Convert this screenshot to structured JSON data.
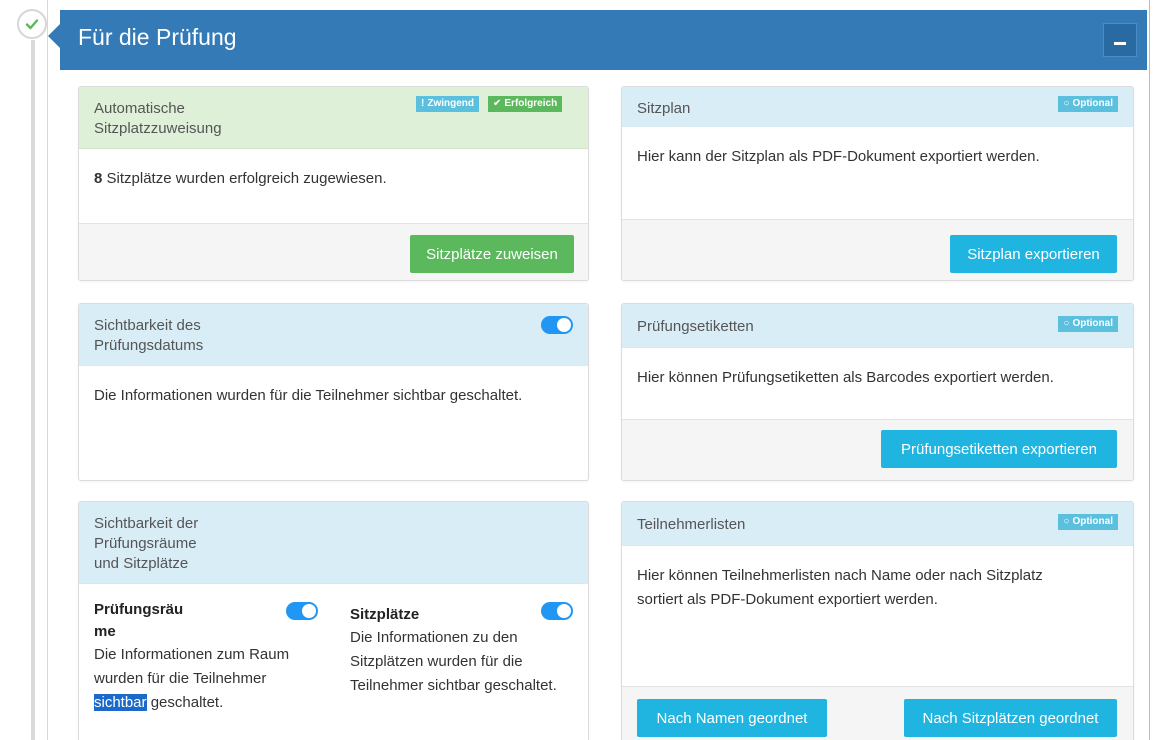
{
  "header": {
    "title": "Für die Prüfung",
    "collapse_icon": "minus-icon"
  },
  "panels": {
    "seat_assignment": {
      "title_line1": "Automatische",
      "title_line2": "Sitzplatzzuweisung",
      "badge_mandatory": "Zwingend",
      "badge_success": "Erfolgreich",
      "count": "8",
      "body": " Sitzplätze wurden erfolgreich zugewiesen.",
      "button": "Sitzplätze zuweisen"
    },
    "seat_plan": {
      "title": "Sitzplan",
      "badge": "Optional",
      "body": "Hier kann der Sitzplan als PDF-Dokument exportiert werden.",
      "button": "Sitzplan exportieren"
    },
    "date_visibility": {
      "title_line1": "Sichtbarkeit des",
      "title_line2": "Prüfungsdatums",
      "toggle_on": true,
      "body": "Die Informationen wurden für die Teilnehmer sichtbar geschaltet."
    },
    "exam_labels": {
      "title": "Prüfungsetiketten",
      "badge": "Optional",
      "body": "Hier können Prüfungsetiketten als Barcodes exportiert werden.",
      "button": "Prüfungsetiketten exportieren"
    },
    "room_visibility": {
      "title_line1": "Sichtbarkeit der",
      "title_line2": "Prüfungsräume",
      "title_line3": "und Sitzplätze",
      "rooms": {
        "title_line1": "Prüfungsräu",
        "title_line2": "me",
        "text_line1": "Die Informationen zum Raum",
        "text_line2": "wurden für die Teilnehmer",
        "text_highlight": "sichtbar",
        "text_rest": " geschaltet."
      },
      "seats": {
        "title": "Sitzplätze",
        "text_line1": "Die Informationen zu den",
        "text_line2": "Sitzplätzen wurden für die",
        "text_line3": "Teilnehmer sichtbar geschaltet."
      }
    },
    "participant_lists": {
      "title": "Teilnehmerlisten",
      "badge": "Optional",
      "body_line1": "Hier können Teilnehmerlisten nach Name oder nach Sitzplatz",
      "body_line2": "sortiert als PDF-Dokument exportiert werden.",
      "button_name": "Nach Namen geordnet",
      "button_seat": "Nach Sitzplätzen geordnet"
    }
  },
  "colors": {
    "primary": "#337ab7",
    "info": "#1fb5e0",
    "success": "#5cb85c",
    "toggle": "#2196f3"
  }
}
